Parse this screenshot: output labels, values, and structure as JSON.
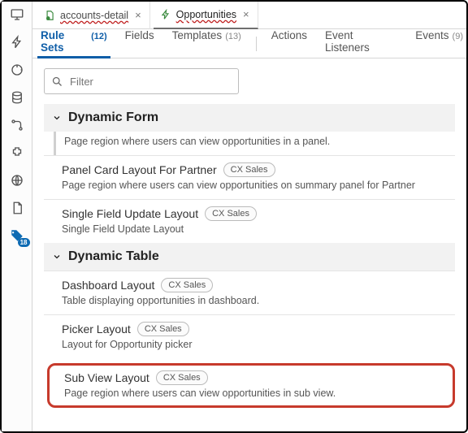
{
  "sidebar": {
    "badge": "18"
  },
  "tabs": [
    {
      "label": "accounts-detail",
      "active": false
    },
    {
      "label": "Opportunities",
      "active": true
    }
  ],
  "subtabs": {
    "rule_sets": {
      "label": "Rule Sets",
      "count": "(12)"
    },
    "fields": {
      "label": "Fields"
    },
    "templates": {
      "label": "Templates",
      "count": "(13)"
    },
    "actions": {
      "label": "Actions"
    },
    "event_listeners": {
      "label": "Event Listeners"
    },
    "events": {
      "label": "Events",
      "count": "(9)"
    }
  },
  "filter": {
    "placeholder": "Filter",
    "value": ""
  },
  "sections": {
    "dynamic_form": {
      "title": "Dynamic Form",
      "items": [
        {
          "title": "",
          "chip": "",
          "desc": "Page region where users can view opportunities in a panel."
        },
        {
          "title": "Panel Card Layout For Partner",
          "chip": "CX Sales",
          "desc": "Page region where users can view opportunities on summary panel for Partner"
        },
        {
          "title": "Single Field Update Layout",
          "chip": "CX Sales",
          "desc": "Single Field Update Layout"
        }
      ]
    },
    "dynamic_table": {
      "title": "Dynamic Table",
      "items": [
        {
          "title": "Dashboard Layout",
          "chip": "CX Sales",
          "desc": "Table displaying opportunities in dashboard."
        },
        {
          "title": "Picker Layout",
          "chip": "CX Sales",
          "desc": "Layout for Opportunity picker"
        },
        {
          "title": "Sub View Layout",
          "chip": "CX Sales",
          "desc": "Page region where users can view opportunities in sub view."
        }
      ]
    }
  }
}
